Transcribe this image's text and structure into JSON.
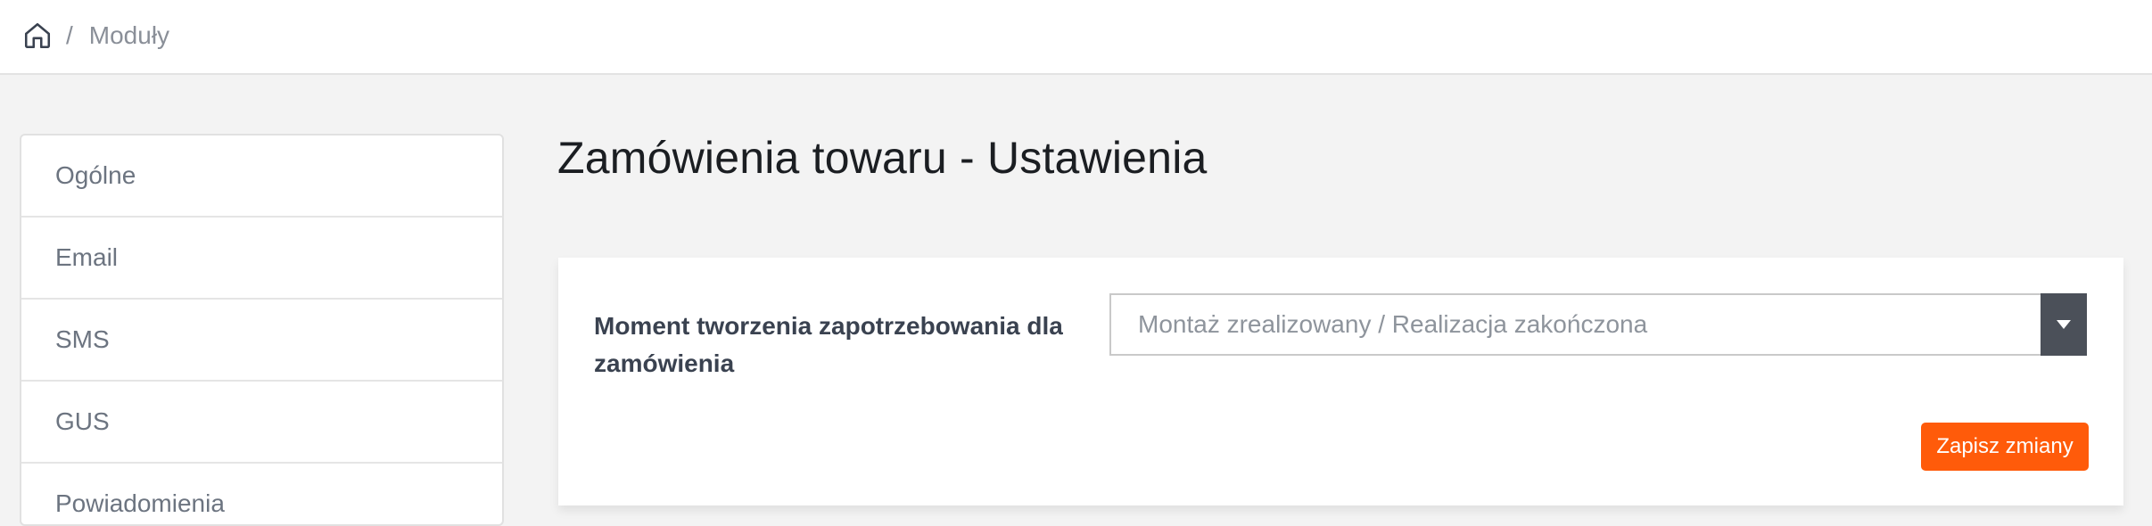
{
  "breadcrumb": {
    "home_icon": "home-icon",
    "separator": "/",
    "current": "Moduły"
  },
  "sidebar": {
    "items": [
      {
        "label": "Ogólne"
      },
      {
        "label": "Email"
      },
      {
        "label": "SMS"
      },
      {
        "label": "GUS"
      },
      {
        "label": "Powiadomienia"
      }
    ]
  },
  "page": {
    "title": "Zamówienia towaru - Ustawienia"
  },
  "form": {
    "field_label": "Moment tworzenia zapotrzebowania dla zamówienia",
    "select_value": "Montaż zrealizowany / Realizacja zakończona",
    "select_icon": "chevron-down-icon",
    "save_label": "Zapisz zmiany"
  },
  "colors": {
    "accent": "#ff5b0a",
    "select_arrow_bg": "#4b5059"
  }
}
